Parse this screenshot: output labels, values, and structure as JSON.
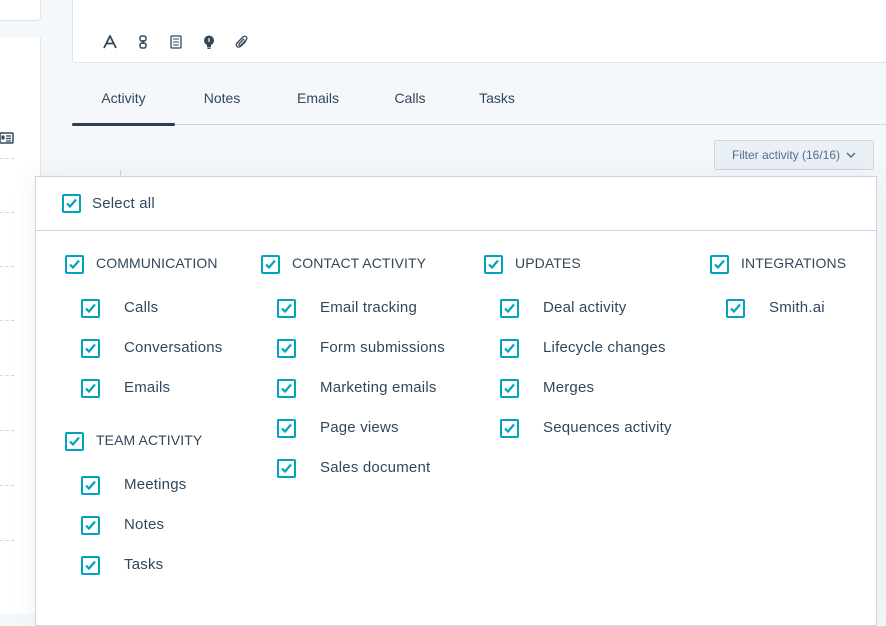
{
  "toolbar": {
    "icons": [
      "text-format-icon",
      "link-icon",
      "document-icon",
      "lightbulb-icon",
      "paperclip-icon"
    ]
  },
  "tabs": [
    {
      "label": "Activity",
      "active": true
    },
    {
      "label": "Notes",
      "active": false
    },
    {
      "label": "Emails",
      "active": false
    },
    {
      "label": "Calls",
      "active": false
    },
    {
      "label": "Tasks",
      "active": false
    }
  ],
  "filter": {
    "label": "Filter activity (16/16)"
  },
  "dropdown": {
    "select_all": {
      "label": "Select all",
      "checked": true
    },
    "groups": {
      "communication": {
        "title": "COMMUNICATION",
        "items": [
          "Calls",
          "Conversations",
          "Emails"
        ]
      },
      "team_activity": {
        "title": "TEAM ACTIVITY",
        "items": [
          "Meetings",
          "Notes",
          "Tasks"
        ]
      },
      "contact_activity": {
        "title": "CONTACT ACTIVITY",
        "items": [
          "Email tracking",
          "Form submissions",
          "Marketing emails",
          "Page views",
          "Sales document"
        ]
      },
      "updates": {
        "title": "UPDATES",
        "items": [
          "Deal activity",
          "Lifecycle changes",
          "Merges",
          "Sequences activity"
        ]
      },
      "integrations": {
        "title": "INTEGRATIONS",
        "items": [
          "Smith.ai"
        ]
      }
    }
  },
  "colors": {
    "accent": "#00a4bd",
    "text": "#33475b",
    "border": "#cbd6e2",
    "tab_indicator": "#2d3e50"
  }
}
